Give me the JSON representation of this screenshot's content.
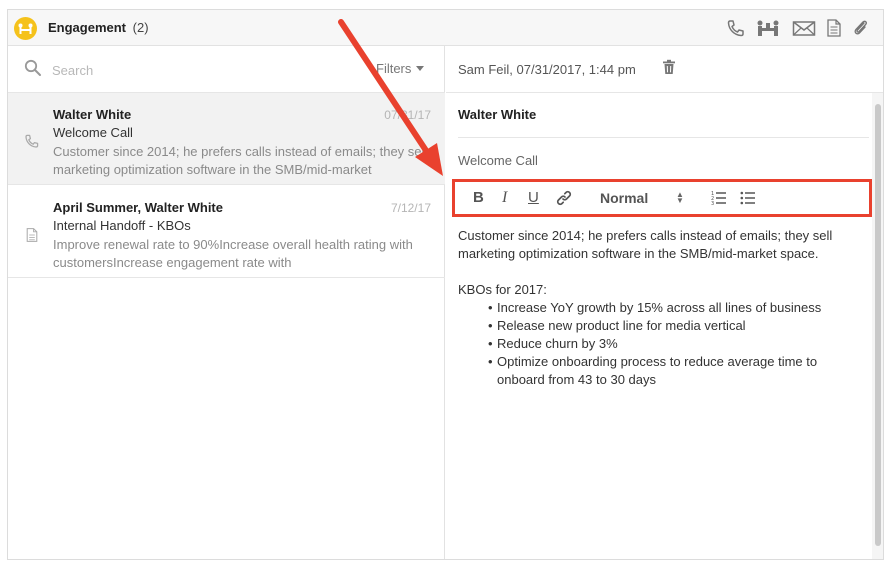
{
  "header": {
    "title": "Engagement",
    "count": "(2)"
  },
  "search": {
    "placeholder": "Search"
  },
  "filters": {
    "label": "Filters"
  },
  "engagements": [
    {
      "type": "call",
      "icon": "phone-icon",
      "names": "Walter White",
      "date": "07/31/17",
      "subject": "Welcome Call",
      "preview": "Customer since 2014; he prefers calls instead of emails; they sell marketing optimization software in the SMB/mid-market"
    },
    {
      "type": "note",
      "icon": "document-icon",
      "names": "April Summer, Walter White",
      "date": "7/12/17",
      "subject": "Internal Handoff - KBOs",
      "preview": "Improve renewal rate to 90%Increase overall health rating with customersIncrease engagement rate with"
    }
  ],
  "detail": {
    "meta": "Sam Feil, 07/31/2017, 1:44 pm",
    "to": "Walter White",
    "subject": "Welcome Call",
    "toolbar": {
      "bold": "B",
      "italic": "I",
      "underline": "U",
      "format": "Normal"
    },
    "body_intro": "Customer since 2014; he prefers calls instead of emails; they sell marketing optimization software in the SMB/mid-market space.",
    "kbo_title": "KBOs for 2017:",
    "kbos": [
      "Increase YoY growth by 15% across all lines of business",
      "Release new product line for media vertical",
      "Reduce churn by 3%",
      "Optimize onboarding process to reduce average time to onboard from 43 to 30 days"
    ]
  },
  "colors": {
    "logo": "#f5c21b",
    "highlight": "#e9412e",
    "selected_row": "#f2f2f2"
  }
}
